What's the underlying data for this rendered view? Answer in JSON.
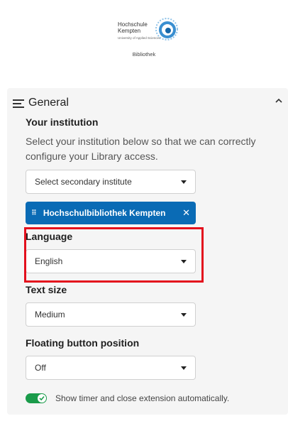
{
  "header": {
    "logo": {
      "line1": "Hochschule",
      "line2": "Kempten",
      "subtitle": "University of Applied Sciences"
    },
    "library_label": "Bibliothek"
  },
  "panel": {
    "title": "General",
    "institution": {
      "label": "Your institution",
      "description": "Select your institution below so that we can correctly configure your Library access.",
      "select_placeholder": "Select secondary institute",
      "selected_chip": "Hochschulbibliothek Kempten"
    },
    "language": {
      "label": "Language",
      "value": "English"
    },
    "text_size": {
      "label": "Text size",
      "value": "Medium"
    },
    "floating_button": {
      "label": "Floating button position",
      "value": "Off"
    },
    "timer_toggle": {
      "label": "Show timer and close extension automatically.",
      "enabled": true
    }
  },
  "colors": {
    "accent": "#0a6bb5",
    "toggle_on": "#1a9b4a",
    "highlight": "#e3101d"
  }
}
